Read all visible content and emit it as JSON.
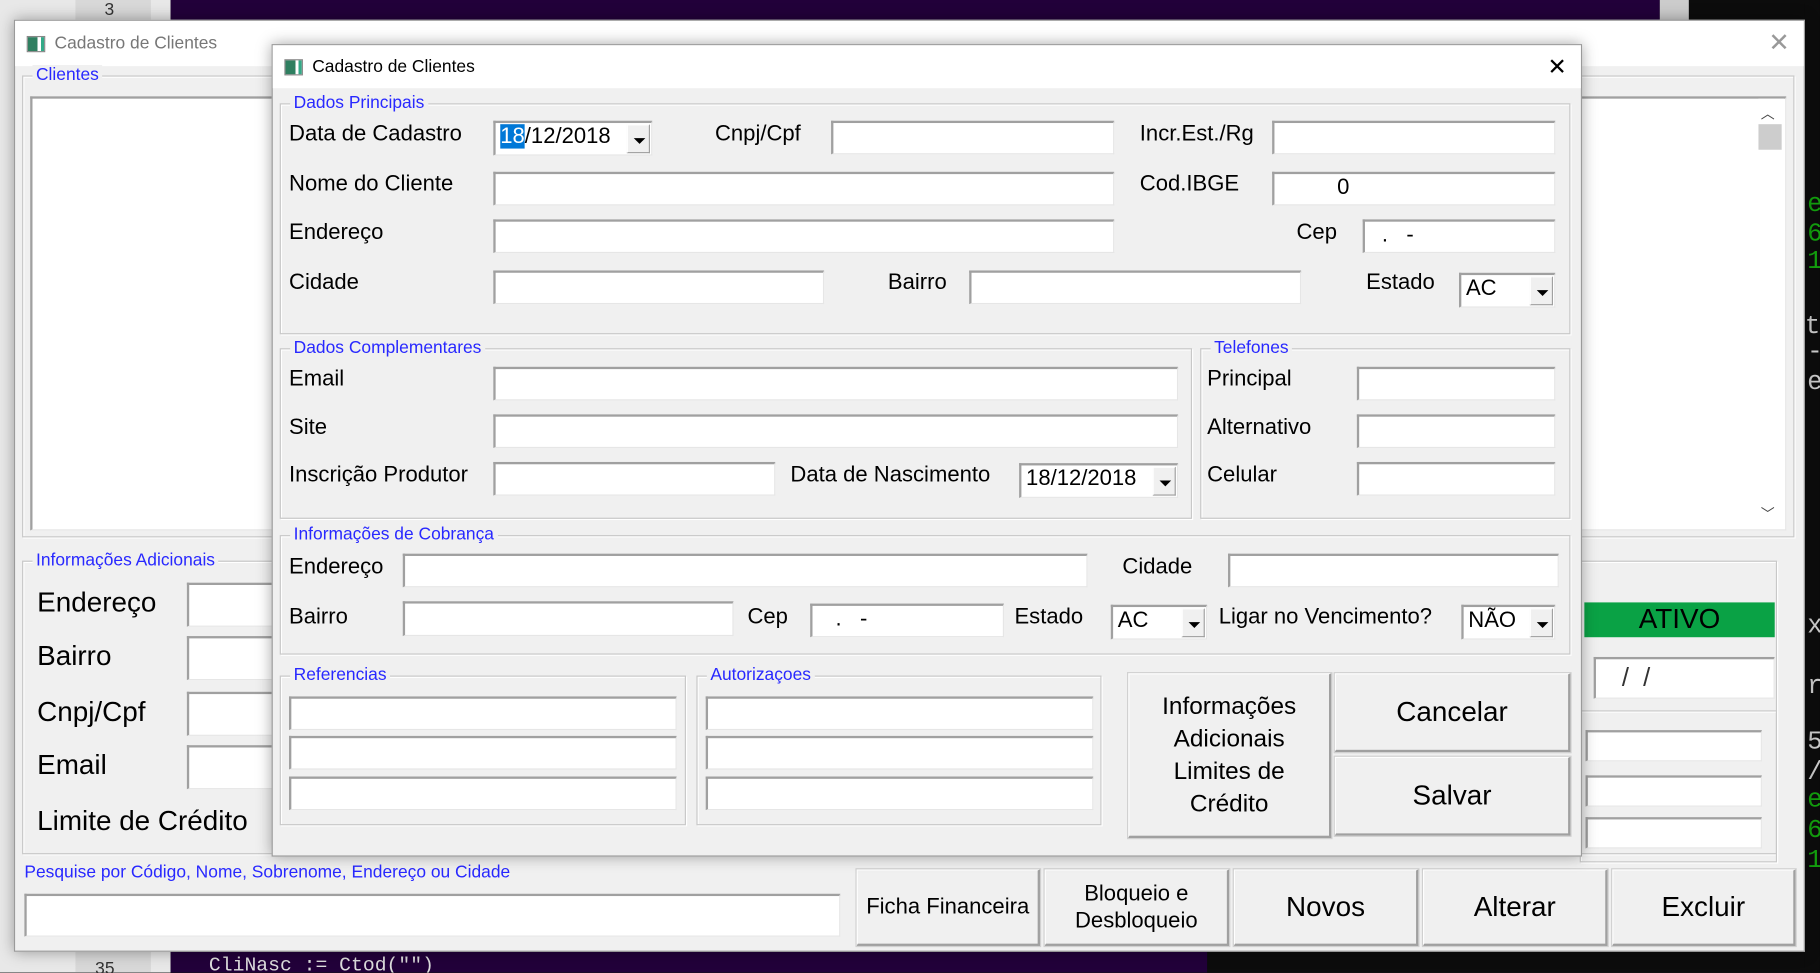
{
  "background": {
    "line_number_top": "3",
    "line_number_bottom": "35",
    "code_line": "CliNasc  := Ctod(\"\")",
    "terminal_chars": [
      "e",
      "6",
      "1",
      "t",
      "-",
      "e",
      "x",
      "r",
      "5",
      "/",
      "e",
      "6",
      "1"
    ]
  },
  "outer_window": {
    "title": "Cadastro de Clientes",
    "clientes_group": "Clientes",
    "info_group": "Informações Adicionais",
    "info_labels": [
      "Endereço",
      "Bairro",
      "Cnpj/Cpf",
      "Email",
      "Limite de Crédito"
    ],
    "status": "ATIVO",
    "status_color": "#0aa245",
    "date_value": "   /  /",
    "search_label": "Pesquise por Código, Nome, Sobrenome, Endereço ou Cidade",
    "search_value": "",
    "buttons": [
      "Ficha Financeira",
      "Bloqueio e Desbloqueio",
      "Novos",
      "Alterar",
      "Excluir"
    ]
  },
  "dialog": {
    "title": "Cadastro de Clientes",
    "dados_principais": {
      "title": "Dados Principais",
      "data_cadastro_label": "Data de Cadastro",
      "data_cadastro_sel": "18",
      "data_cadastro_rest": "/12/2018",
      "cnpj_label": "Cnpj/Cpf",
      "cnpj": "",
      "incr_label": "Incr.Est./Rg",
      "incr": "",
      "nome_label": "Nome do Cliente",
      "nome": "",
      "ibge_label": "Cod.IBGE",
      "ibge": "0",
      "endereco_label": "Endereço",
      "endereco": "",
      "cep_label": "Cep",
      "cep": "  .   -",
      "cidade_label": "Cidade",
      "cidade": "",
      "bairro_label": "Bairro",
      "bairro": "",
      "estado_label": "Estado",
      "estado": "AC"
    },
    "dados_complementares": {
      "title": "Dados Complementares",
      "email_label": "Email",
      "site_label": "Site",
      "inscricao_label": "Inscrição Produtor",
      "nascimento_label": "Data de Nascimento",
      "nascimento": "18/12/2018"
    },
    "telefones": {
      "title": "Telefones",
      "principal_label": "Principal",
      "alternativo_label": "Alternativo",
      "celular_label": "Celular"
    },
    "cobranca": {
      "title": "Informações de Cobrança",
      "endereco_label": "Endereço",
      "cidade_label": "Cidade",
      "bairro_label": "Bairro",
      "cep_label": "Cep",
      "cep": "   .   -",
      "estado_label": "Estado",
      "estado": "AC",
      "ligar_label": "Ligar no Vencimento?",
      "ligar": "NÃO"
    },
    "referencias": {
      "title": "Referencias"
    },
    "autorizacoes": {
      "title": "Autorizaçoes"
    },
    "buttons": {
      "info": "Informações Adicionais Limites de Crédito",
      "cancelar": "Cancelar",
      "salvar": "Salvar"
    }
  }
}
